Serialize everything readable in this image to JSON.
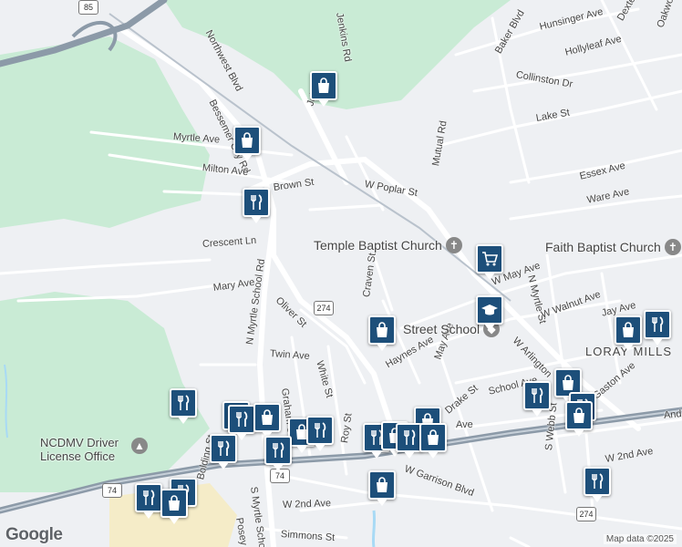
{
  "map": {
    "attribution": "Map data ©2025",
    "logo": "Google",
    "colors": {
      "park": "#c9ebd5",
      "road": "#ffffff",
      "highway": "#8c9aa8",
      "marker": "#1d4f7a",
      "water": "#a8daf5"
    }
  },
  "streets": [
    "Jenkins Rd",
    "Northwest Blvd",
    "Bessemer City Rd",
    "Myrtle Ave",
    "Milton Ave",
    "Brown St",
    "Crescent Ln",
    "Mary Ave",
    "Oliver St",
    "N Myrtle School Rd",
    "Twin Ave",
    "Graham St",
    "White St",
    "Craven St",
    "Haynes Ave",
    "May Ave",
    "W Poplar St",
    "Mutual Rd",
    "Hunsinger Ave",
    "Dexter Ave",
    "Oakwood Ave",
    "Baker Blvd",
    "Hollyleaf Ave",
    "Collinston Dr",
    "Lake St",
    "Essex Ave",
    "Ware Ave",
    "W May Ave",
    "N Myrtle St",
    "W Walnut Ave",
    "Jay Ave",
    "W Arlington",
    "Gaston Ave",
    "School Ave",
    "Drake St",
    "Roy St",
    "W Garrison Blvd",
    "W 2nd Ave",
    "Bolding St",
    "Posey St",
    "S Myrtle School Rd",
    "Simmons St",
    "S Webb St",
    "Ave",
    "Jel",
    "Andr"
  ],
  "places": {
    "temple_church": "Temple Baptist Church",
    "faith_church": "Faith Baptist Church",
    "school": "Street School",
    "mills": "LORAY MILLS",
    "dmv": "NCDMV Driver License Office"
  },
  "highways": {
    "i85": "85",
    "us74": "74",
    "nc274": "274"
  },
  "markers": [
    {
      "type": "shopping"
    },
    {
      "type": "shopping"
    },
    {
      "type": "restaurant"
    },
    {
      "type": "grocery"
    },
    {
      "type": "school"
    },
    {
      "type": "shopping"
    },
    {
      "type": "shopping"
    },
    {
      "type": "restaurant"
    },
    {
      "type": "restaurant"
    },
    {
      "type": "shopping"
    },
    {
      "type": "restaurant"
    },
    {
      "type": "shopping"
    },
    {
      "type": "shopping"
    },
    {
      "type": "restaurant"
    },
    {
      "type": "restaurant"
    },
    {
      "type": "restaurant"
    },
    {
      "type": "shopping"
    },
    {
      "type": "shopping"
    },
    {
      "type": "restaurant"
    },
    {
      "type": "restaurant"
    },
    {
      "type": "shopping"
    },
    {
      "type": "restaurant"
    },
    {
      "type": "shopping"
    },
    {
      "type": "restaurant"
    },
    {
      "type": "restaurant"
    },
    {
      "type": "shopping"
    },
    {
      "type": "restaurant"
    },
    {
      "type": "restaurant"
    },
    {
      "type": "shopping"
    },
    {
      "type": "restaurant"
    }
  ]
}
